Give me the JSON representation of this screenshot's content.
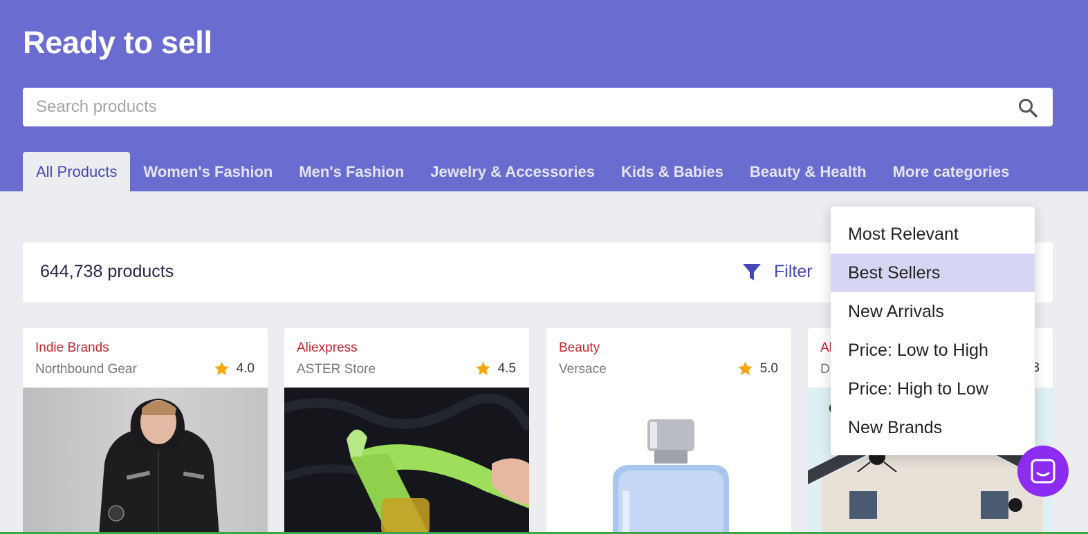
{
  "header": {
    "title": "Ready to sell",
    "search_placeholder": "Search products"
  },
  "tabs": [
    {
      "label": "All Products",
      "active": true
    },
    {
      "label": "Women's Fashion"
    },
    {
      "label": "Men's Fashion"
    },
    {
      "label": "Jewelry & Accessories"
    },
    {
      "label": "Kids & Babies"
    },
    {
      "label": "Beauty & Health"
    },
    {
      "label": "More categories"
    }
  ],
  "toolbar": {
    "count": "644,738 products",
    "filter_label": "Filter"
  },
  "sort_menu": {
    "items": [
      "Most Relevant",
      "Best Sellers",
      "New Arrivals",
      "Price: Low to High",
      "Price: High to Low",
      "New Brands"
    ],
    "selected": "Best Sellers"
  },
  "products": [
    {
      "category": "Indie Brands",
      "store": "Northbound Gear",
      "rating": "4.0",
      "image": "black-jacket-model"
    },
    {
      "category": "Aliexpress",
      "store": "ASTER Store",
      "rating": "4.5",
      "image": "green-citrus-press"
    },
    {
      "category": "Beauty",
      "store": "Versace",
      "rating": "5.0",
      "image": "perfume-bottle"
    },
    {
      "category": "Al",
      "store": "D",
      "rating": "3",
      "image": "halloween-spider-house"
    }
  ],
  "colors": {
    "header_bg": "#6b6ccf",
    "accent": "#4547b9",
    "category_red": "#c0262d",
    "star": "#f2a70d",
    "chat_bubble": "#8b2cf0",
    "selected_bg": "#d6d6f4"
  }
}
